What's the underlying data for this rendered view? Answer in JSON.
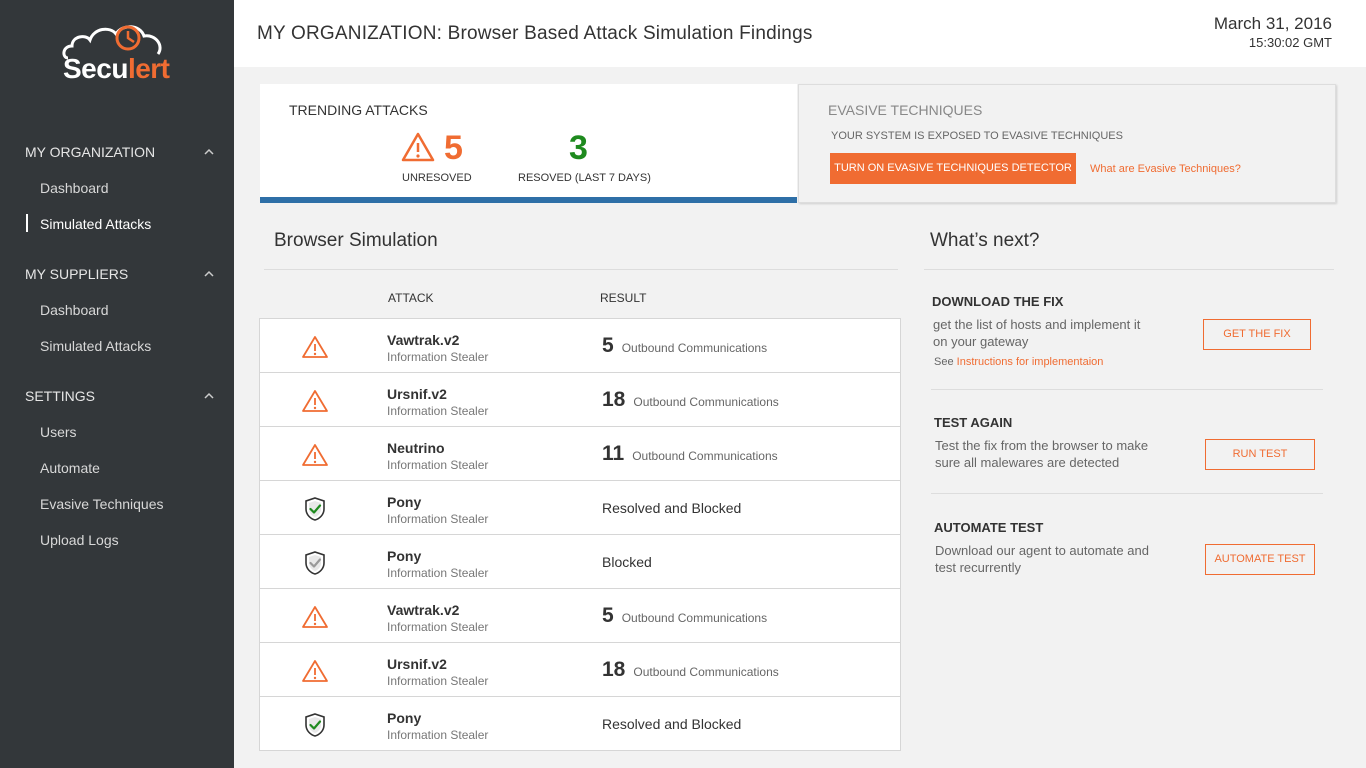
{
  "brand": {
    "name_prefix": "Secu",
    "name_suffix": "lert",
    "accent": "#f06c32"
  },
  "sidebar": {
    "sections": [
      {
        "label": "MY ORGANIZATION",
        "items": [
          "Dashboard",
          "Simulated Attacks"
        ]
      },
      {
        "label": "MY SUPPLIERS",
        "items": [
          "Dashboard",
          "Simulated Attacks"
        ]
      },
      {
        "label": "SETTINGS",
        "items": [
          "Users",
          "Automate",
          "Evasive Techniques",
          "Upload Logs"
        ]
      }
    ],
    "active_item": "Simulated Attacks"
  },
  "header": {
    "title": "MY ORGANIZATION: Browser Based Attack Simulation Findings",
    "date": "March 31, 2016",
    "time": "15:30:02 GMT"
  },
  "trending": {
    "title": "TRENDING ATTACKS",
    "unresolved_count": "5",
    "unresolved_label": "UNRESOVED",
    "resolved_count": "3",
    "resolved_label": "RESOVED (LAST 7 DAYS)",
    "bar_color": "#2e6fa7"
  },
  "evasive": {
    "title": "EVASIVE TECHNIQUES",
    "subtitle": "YOUR SYSTEM IS EXPOSED TO EVASIVE TECHNIQUES",
    "button": "TURN ON EVASIVE TECHNIQUES DETECTOR",
    "link": "What are Evasive Techniques?"
  },
  "simulation": {
    "title": "Browser Simulation",
    "columns": {
      "attack": "ATTACK",
      "result": "RESULT"
    },
    "rows": [
      {
        "icon": "warning-icon",
        "name": "Vawtrak.v2",
        "type": "Information Stealer",
        "count": "5",
        "result": "Outbound Communications"
      },
      {
        "icon": "warning-icon",
        "name": "Ursnif.v2",
        "type": "Information Stealer",
        "count": "18",
        "result": "Outbound Communications"
      },
      {
        "icon": "warning-icon",
        "name": "Neutrino",
        "type": "Information Stealer",
        "count": "11",
        "result": "Outbound Communications"
      },
      {
        "icon": "shield-check-icon",
        "name": "Pony",
        "type": "Information Stealer",
        "count": "",
        "result": "Resolved and Blocked"
      },
      {
        "icon": "shield-check-gray-icon",
        "name": "Pony",
        "type": "Information Stealer",
        "count": "",
        "result": "Blocked"
      },
      {
        "icon": "warning-icon",
        "name": "Vawtrak.v2",
        "type": "Information Stealer",
        "count": "5",
        "result": "Outbound Communications"
      },
      {
        "icon": "warning-icon",
        "name": "Ursnif.v2",
        "type": "Information Stealer",
        "count": "18",
        "result": "Outbound Communications"
      },
      {
        "icon": "shield-check-icon",
        "name": "Pony",
        "type": "Information Stealer",
        "count": "",
        "result": "Resolved and Blocked"
      }
    ]
  },
  "next": {
    "title": "What’s next?",
    "download": {
      "title": "DOWNLOAD THE FIX",
      "text": "get the list of hosts and implement it on your gateway",
      "note_prefix": "See ",
      "note_link": "Instructions for implementaion",
      "button": "GET THE FIX"
    },
    "test": {
      "title": "TEST AGAIN",
      "text": "Test the fix from the browser to make sure all malewares are detected",
      "button": "RUN TEST"
    },
    "automate": {
      "title": "AUTOMATE TEST",
      "text": "Download our agent to automate and test recurrently",
      "button": "AUTOMATE TEST"
    }
  }
}
